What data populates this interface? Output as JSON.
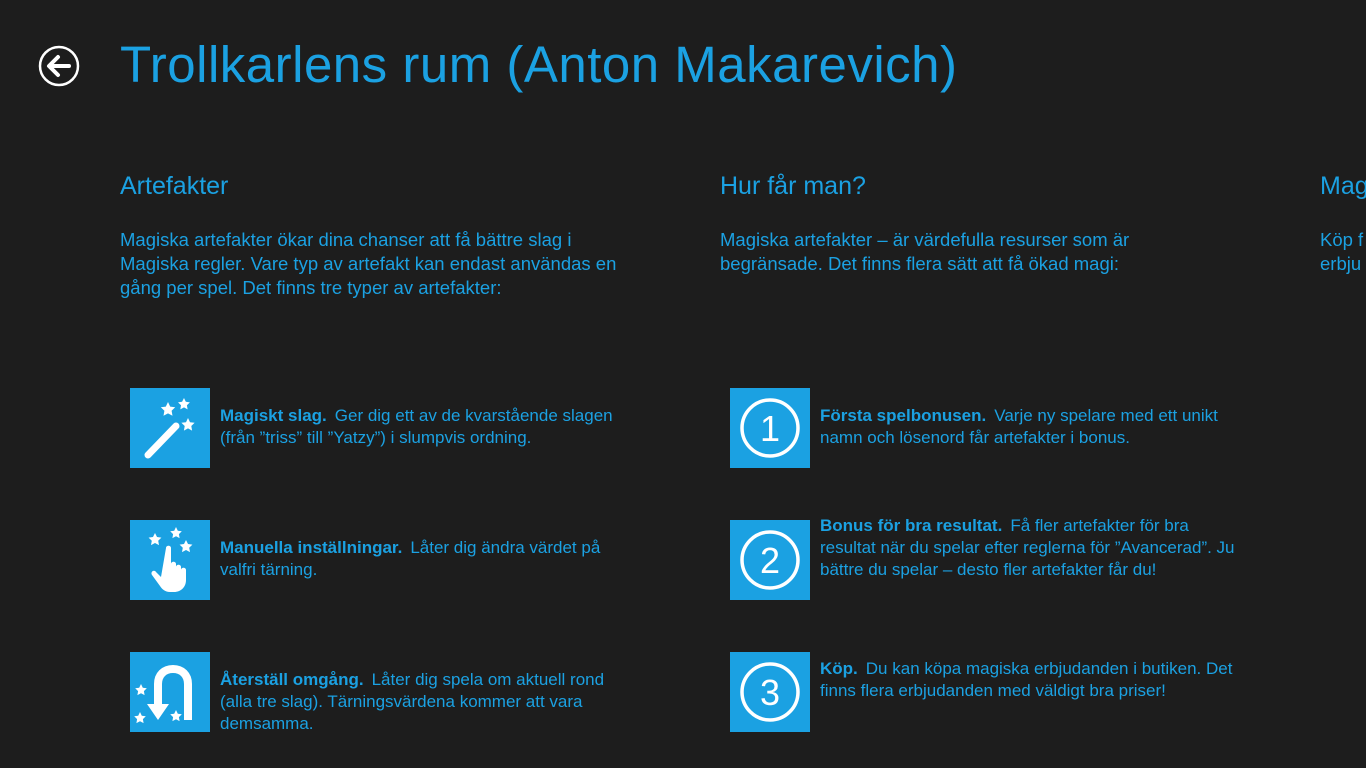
{
  "header": {
    "title": "Trollkarlens rum (Anton Makarevich)"
  },
  "colors": {
    "accent": "#1ba1e2",
    "background": "#1d1d1d",
    "icon": "#ffffff"
  },
  "sections": [
    {
      "heading": "Artefakter",
      "intro": "Magiska artefakter ökar dina chanser att få bättre slag i Magiska regler. Vare typ av artefakt kan endast användas en gång per spel. Det finns tre typer av artefakter:",
      "items": [
        {
          "icon": "magic-wand-icon",
          "title": "Magiskt slag.",
          "text": "Ger dig ett av de kvarstående slagen (från ”triss” till ”Yatzy”) i slumpvis ordning."
        },
        {
          "icon": "pointing-hand-icon",
          "title": "Manuella inställningar.",
          "text": "Låter dig ändra värdet på valfri tärning."
        },
        {
          "icon": "u-turn-arrow-icon",
          "title": "Återställ omgång.",
          "text": "Låter dig spela om aktuell rond (alla tre slag). Tärningsvärdena kommer att vara demsamma."
        }
      ]
    },
    {
      "heading": "Hur får man?",
      "intro": "Magiska artefakter – är värdefulla resurser som är begränsade. Det finns flera sätt att få ökad magi:",
      "items": [
        {
          "icon": "number-1-icon",
          "number": "1",
          "title": "Första spelbonusen.",
          "text": "Varje ny spelare med ett unikt namn och lösenord får artefakter i bonus."
        },
        {
          "icon": "number-2-icon",
          "number": "2",
          "title": "Bonus för bra resultat.",
          "text": "Få fler artefakter för bra resultat när du spelar efter reglerna för ”Avancerad”. Ju bättre du spelar – desto fler artefakter får du!"
        },
        {
          "icon": "number-3-icon",
          "number": "3",
          "title": "Köp.",
          "text": "Du kan köpa magiska erbjudanden i butiken. Det finns flera erbjudanden med väldigt bra priser!"
        }
      ]
    },
    {
      "heading": "Mag",
      "intro_line1": "Köp f",
      "intro_line2": "erbju"
    }
  ]
}
